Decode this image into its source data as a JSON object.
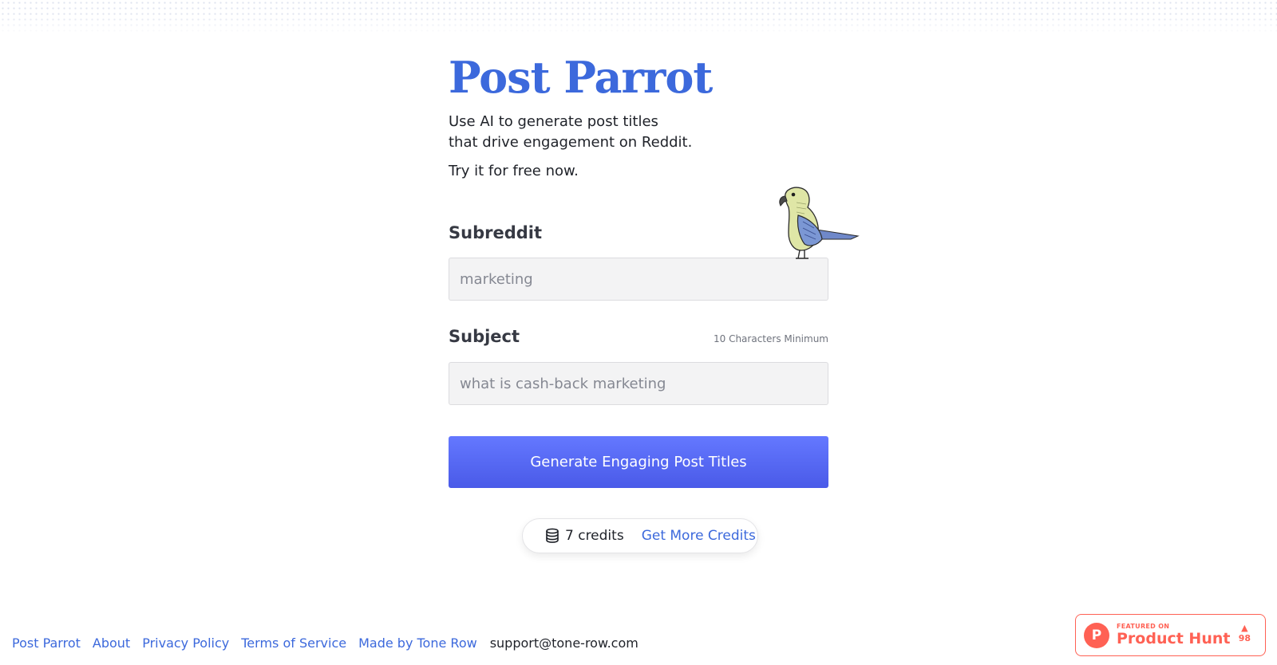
{
  "header": {
    "title": "Post Parrot",
    "tagline_line1": "Use AI to generate post titles",
    "tagline_line2": "that drive engagement on Reddit.",
    "free_text": "Try it for free now."
  },
  "form": {
    "subreddit_label": "Subreddit",
    "subreddit_placeholder": "marketing",
    "subject_label": "Subject",
    "subject_hint": "10 Characters Minimum",
    "subject_placeholder": "what is cash-back marketing",
    "generate_button": "Generate Engaging Post Titles"
  },
  "credits": {
    "icon": "coins-stack-icon",
    "text": "7 credits",
    "link": "Get More Credits"
  },
  "footer": {
    "links": [
      "Post Parrot",
      "About",
      "Privacy Policy",
      "Terms of Service",
      "Made by Tone Row"
    ],
    "email": "support@tone-row.com"
  },
  "product_hunt": {
    "featured_on": "FEATURED ON",
    "name": "Product Hunt",
    "logo_letter": "P",
    "votes": "98"
  },
  "colors": {
    "accent": "#3c69dc",
    "button": "#5566f0",
    "product_hunt": "#ff6154"
  }
}
